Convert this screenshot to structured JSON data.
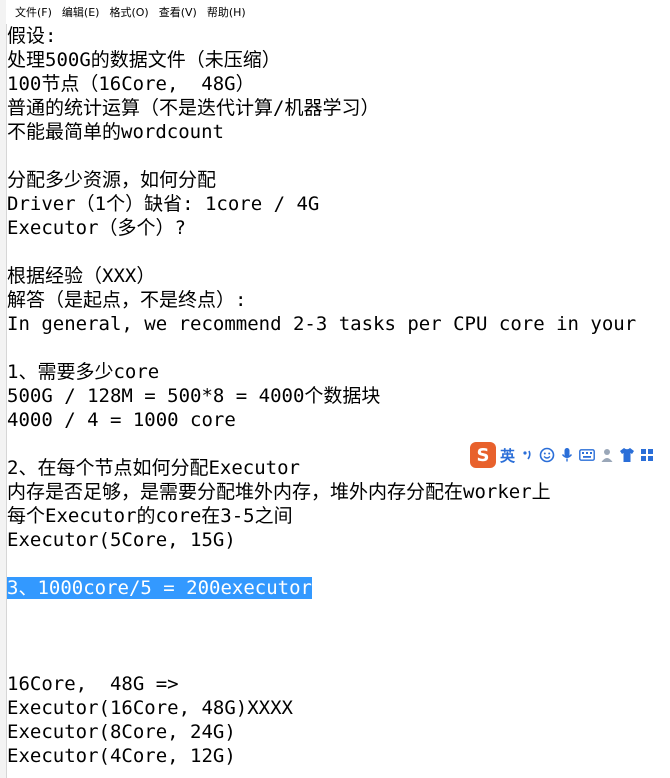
{
  "menu": [
    "文件(F)",
    "编辑(E)",
    "格式(O)",
    "查看(V)",
    "帮助(H)"
  ],
  "lines": [
    "假设:",
    "处理500G的数据文件（未压缩）",
    "100节点（16Core,  48G）",
    "普通的统计运算（不是迭代计算/机器学习）",
    "不能最简单的wordcount",
    "",
    "分配多少资源，如何分配",
    "Driver（1个）缺省: 1core / 4G",
    "Executor（多个）?",
    "",
    "根据经验（XXX）",
    "解答（是起点，不是终点）:",
    "In general, we recommend 2-3 tasks per CPU core in your",
    "",
    "1、需要多少core",
    "500G / 128M = 500*8 = 4000个数据块",
    "4000 / 4 = 1000 core",
    "",
    "2、在每个节点如何分配Executor",
    "内存是否足够，是需要分配堆外内存，堆外内存分配在worker上",
    "每个Executor的core在3-5之间",
    "Executor(5Core, 15G)",
    "",
    "3、1000core/5 = 200executor",
    "",
    "",
    "",
    "16Core,  48G =>",
    "Executor(16Core, 48G)XXXX",
    "Executor(8Core, 24G)",
    "Executor(4Core, 12G)"
  ],
  "selected_line_index": 23,
  "ime": {
    "logo": "S",
    "lang": "英",
    "icons": [
      "punctuation-icon",
      "emoji-icon",
      "microphone-icon",
      "keyboard-icon",
      "user-icon",
      "shirt-icon",
      "grid-icon"
    ]
  },
  "colors": {
    "selection": "#3399ff",
    "ime_logo": "#e8612c"
  }
}
